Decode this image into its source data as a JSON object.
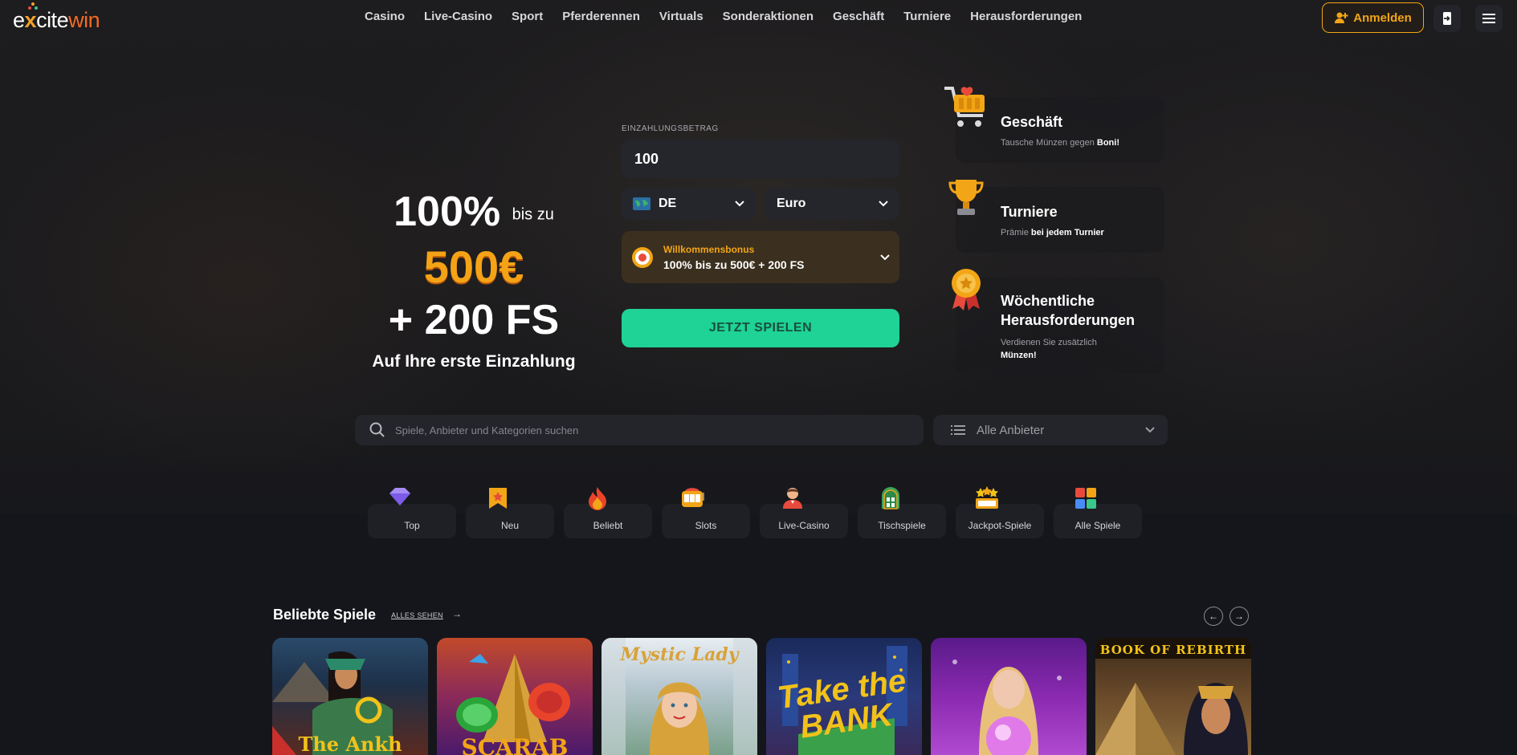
{
  "brand": {
    "logo_e": "e",
    "logo_x": "x",
    "logo_cite": "cite",
    "logo_win": "win"
  },
  "nav": [
    "Casino",
    "Live-Casino",
    "Sport",
    "Pferderennen",
    "Virtuals",
    "Sonderaktionen",
    "Geschäft",
    "Turniere",
    "Herausforderungen"
  ],
  "header": {
    "login_label": "Anmelden",
    "login_icon": "user-plus-icon",
    "enter_icon": "login-door-icon",
    "menu_icon": "hamburger-icon",
    "accent": "#f2a516"
  },
  "hero": {
    "line1_big": "100%",
    "line1_small": "bis zu",
    "line2": "500€",
    "line3": "+ 200 FS",
    "line4": "Auf Ihre erste Einzahlung"
  },
  "deposit": {
    "label": "EINZAHLUNGSBETRAG",
    "amount": "100",
    "country": "DE",
    "currency": "Euro",
    "bonus_title": "Willkommensbonus",
    "bonus_text": "100% bis zu 500€ + 200 FS",
    "play_label": "JETZT SPIELEN",
    "play_color": "#1ed395"
  },
  "promos": [
    {
      "title": "Geschäft",
      "sub_plain": "Tausche Münzen gegen ",
      "sub_bold": "Boni!",
      "icon": "shopping-cart-icon"
    },
    {
      "title": "Turniere",
      "sub_plain": "Prämie ",
      "sub_bold": "bei jedem Turnier",
      "icon": "trophy-icon"
    },
    {
      "title_l1": "Wöchentliche",
      "title_l2": "Herausforderungen",
      "sub_plain": "Verdienen Sie zusätzlich",
      "sub_bold": "Münzen!",
      "icon": "medal-icon"
    }
  ],
  "search": {
    "placeholder": "Spiele, Anbieter und Kategorien suchen",
    "provider_label": "Alle Anbieter"
  },
  "categories": [
    {
      "label": "Top",
      "icon": "diamond-icon"
    },
    {
      "label": "Neu",
      "icon": "new-badge-icon"
    },
    {
      "label": "Beliebt",
      "icon": "fire-icon"
    },
    {
      "label": "Slots",
      "icon": "slot-machine-icon"
    },
    {
      "label": "Live-Casino",
      "icon": "dealer-icon"
    },
    {
      "label": "Tischspiele",
      "icon": "table-games-icon"
    },
    {
      "label": "Jackpot-Spiele",
      "icon": "jackpot-icon"
    },
    {
      "label": "Alle Spiele",
      "icon": "grid-icon"
    }
  ],
  "popular": {
    "title": "Beliebte Spiele",
    "see_all": "ALLES SEHEN",
    "games": [
      {
        "title": "The Ankh"
      },
      {
        "title": "SCARAB"
      },
      {
        "title": "Mystic Lady"
      },
      {
        "title": "Take the BANK"
      },
      {
        "title": ""
      },
      {
        "title": "BOOK OF REBIRTH"
      }
    ]
  }
}
